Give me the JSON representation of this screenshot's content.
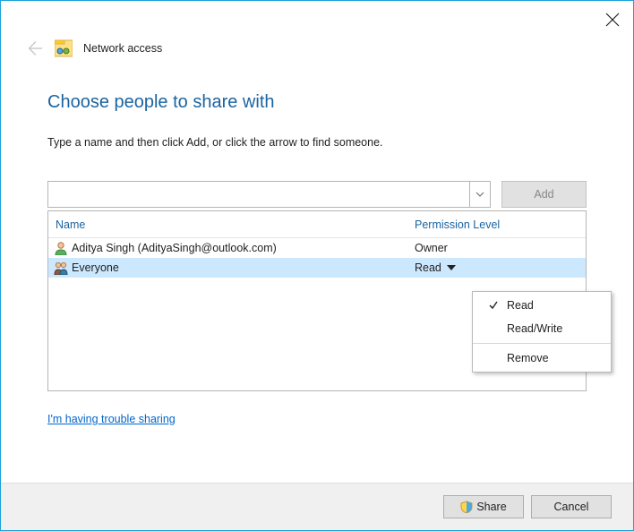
{
  "header": {
    "title_text": "Network access"
  },
  "heading_text": "Choose people to share with",
  "subtext": "Type a name and then click Add, or click the arrow to find someone.",
  "name_input_value": "",
  "add_button_label": "Add",
  "table": {
    "col_name": "Name",
    "col_perm": "Permission Level",
    "rows": [
      {
        "name": "Aditya Singh (AdityaSingh@outlook.com)",
        "perm": "Owner"
      },
      {
        "name": "Everyone",
        "perm": "Read"
      }
    ]
  },
  "trouble_link": "I'm having trouble sharing",
  "menu": {
    "items": [
      "Read",
      "Read/Write"
    ],
    "remove": "Remove",
    "checked_index": 0
  },
  "footer": {
    "share_label": "Share",
    "cancel_label": "Cancel"
  }
}
